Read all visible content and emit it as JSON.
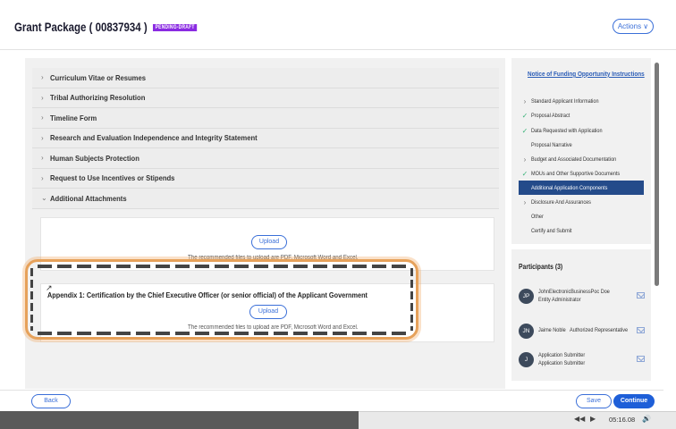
{
  "header": {
    "title": "Grant Package",
    "package_id": "( 00837934 )",
    "status": "PENDING-DRAFT",
    "actions_label": "Actions ∨"
  },
  "accordion": [
    {
      "label": "Curriculum Vitae or Resumes"
    },
    {
      "label": "Tribal Authorizing Resolution"
    },
    {
      "label": "Timeline Form"
    },
    {
      "label": "Research and Evaluation Independence and Integrity Statement"
    },
    {
      "label": "Human Subjects Protection"
    },
    {
      "label": "Request to Use Incentives or Stipends"
    },
    {
      "label": "Additional Attachments",
      "expanded": true
    }
  ],
  "attachments": {
    "upload_label": "Upload",
    "recommended_text": "The recommended files to upload are PDF, Microsoft Word and Excel.",
    "appendix_label": "Appendix 1: Certification by the Chief Executive Officer (or senior official) of the Applicant Government"
  },
  "sidebar": {
    "nofo_link": "Notice of Funding Opportunity Instructions",
    "items": [
      {
        "label": "Standard Applicant Information",
        "mark": "chevron"
      },
      {
        "label": "Proposal Abstract",
        "mark": "check"
      },
      {
        "label": "Data Requested with Application",
        "mark": "check"
      },
      {
        "label": "Proposal Narrative",
        "mark": "none"
      },
      {
        "label": "Budget and Associated Documentation",
        "mark": "chevron"
      },
      {
        "label": "MOUs and Other Supportive Documents",
        "mark": "check"
      },
      {
        "label": "Additional Application Components",
        "mark": "none",
        "active": true
      },
      {
        "label": "Disclosure And Assurances",
        "mark": "chevron"
      },
      {
        "label": "Other",
        "mark": "none"
      },
      {
        "label": "Certify and Submit",
        "mark": "none"
      }
    ]
  },
  "participants": {
    "title": "Participants (3)",
    "list": [
      {
        "initials": "JP",
        "name": "JohnElectronicBusinessPoc Doe",
        "role": "Entity Administrator"
      },
      {
        "initials": "JN",
        "name": "Jaime Noble",
        "role": "Authorized Representative"
      },
      {
        "initials": "J",
        "name": "Application Submitter",
        "role": "Application Submitter"
      }
    ]
  },
  "footer": {
    "back_label": "Back",
    "save_label": "Save",
    "continue_label": "Continue"
  },
  "player": {
    "time": "05:16.08",
    "progress": 0.53
  },
  "colors": {
    "accent": "#3a6fd8",
    "primary_button": "#1e5fd8",
    "active_nav": "#244b8a",
    "highlight": "#e6a15a",
    "status_badge": "#8a2be2",
    "check": "#3bb37a"
  }
}
